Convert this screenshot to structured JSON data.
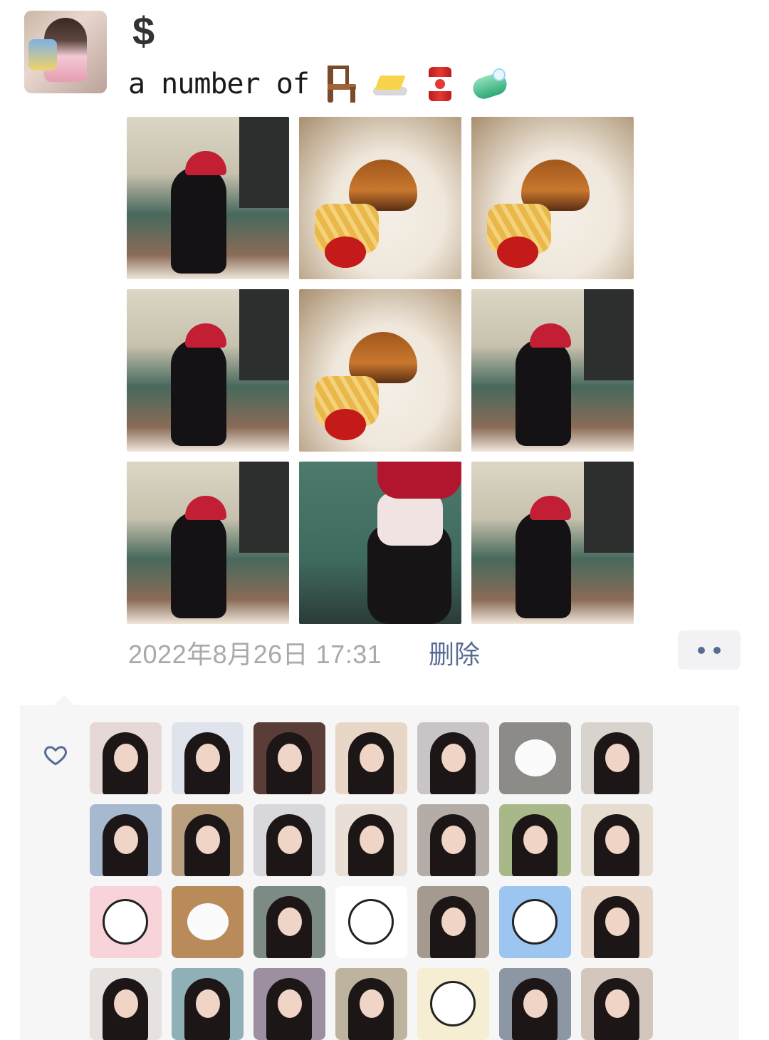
{
  "post": {
    "author_name": "$",
    "text": "a number of",
    "emojis": [
      "chair-icon",
      "butter-icon",
      "canned-food-icon",
      "soap-icon"
    ],
    "photos": [
      {
        "kind": "cafe"
      },
      {
        "kind": "food"
      },
      {
        "kind": "food"
      },
      {
        "kind": "cafe"
      },
      {
        "kind": "food"
      },
      {
        "kind": "cafe"
      },
      {
        "kind": "cafe"
      },
      {
        "kind": "mask"
      },
      {
        "kind": "cafe"
      }
    ],
    "timestamp": "2022年8月26日 17:31",
    "delete_label": "删除"
  },
  "likes": {
    "icon": "heart-icon",
    "avatars": [
      {
        "style": "person",
        "bg": "#e6d8d6"
      },
      {
        "style": "person",
        "bg": "#dfe4ec"
      },
      {
        "style": "person",
        "bg": "#5b3d38"
      },
      {
        "style": "person",
        "bg": "#e8d6c7"
      },
      {
        "style": "person",
        "bg": "#c9c4c5"
      },
      {
        "style": "dog",
        "bg": "#8d8b87"
      },
      {
        "style": "person",
        "bg": "#d9d3cd"
      },
      {
        "style": "person",
        "bg": "#a6b9cf"
      },
      {
        "style": "person",
        "bg": "#bba07f"
      },
      {
        "style": "person",
        "bg": "#d8d7dc"
      },
      {
        "style": "person",
        "bg": "#e9dfd6"
      },
      {
        "style": "person",
        "bg": "#b3aca7"
      },
      {
        "style": "person",
        "bg": "#a9b889"
      },
      {
        "style": "person",
        "bg": "#e6dccf"
      },
      {
        "style": "cartoon",
        "bg": "#f8d3da"
      },
      {
        "style": "dog",
        "bg": "#b98a5a"
      },
      {
        "style": "person",
        "bg": "#7c8b83"
      },
      {
        "style": "cartoon",
        "bg": "#ffffff"
      },
      {
        "style": "person",
        "bg": "#a59a8f"
      },
      {
        "style": "cartoon",
        "bg": "#9cc6ef"
      },
      {
        "style": "person",
        "bg": "#e8d7c9"
      },
      {
        "style": "person",
        "bg": "#e5e2df"
      },
      {
        "style": "person",
        "bg": "#8fb0b6"
      },
      {
        "style": "person",
        "bg": "#9c8f9f"
      },
      {
        "style": "person",
        "bg": "#bdb39f"
      },
      {
        "style": "cartoon",
        "bg": "#f5eed3"
      },
      {
        "style": "person",
        "bg": "#8c97a3"
      },
      {
        "style": "person",
        "bg": "#d3c6bd"
      }
    ]
  },
  "colors": {
    "link": "#576b95",
    "timestamp": "#a9a9a9",
    "panel": "#f6f6f6"
  }
}
